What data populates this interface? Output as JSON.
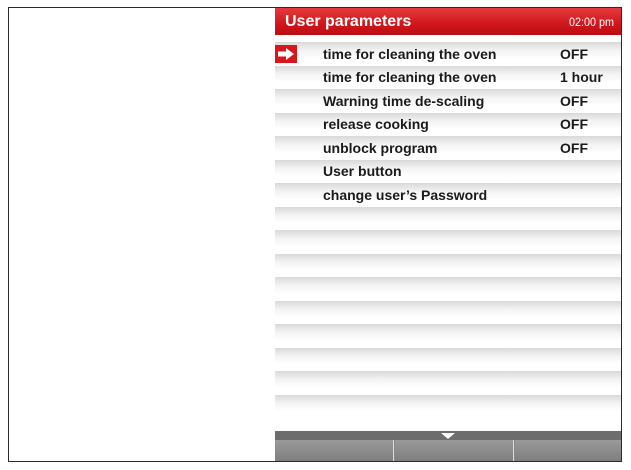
{
  "header": {
    "title": "User parameters",
    "time": "02:00 pm"
  },
  "selected_index": 0,
  "items": [
    {
      "label": "time for cleaning the oven",
      "value": "OFF"
    },
    {
      "label": "time for cleaning the oven",
      "value": "1 hour"
    },
    {
      "label": "Warning time de-scaling",
      "value": "OFF"
    },
    {
      "label": "release cooking",
      "value": "OFF"
    },
    {
      "label": "unblock program",
      "value": "OFF"
    },
    {
      "label": "User button",
      "value": ""
    },
    {
      "label": "change user’s Password",
      "value": ""
    },
    {
      "label": "",
      "value": ""
    },
    {
      "label": "",
      "value": ""
    },
    {
      "label": "",
      "value": ""
    },
    {
      "label": "",
      "value": ""
    },
    {
      "label": "",
      "value": ""
    },
    {
      "label": "",
      "value": ""
    },
    {
      "label": "",
      "value": ""
    },
    {
      "label": "",
      "value": ""
    },
    {
      "label": "",
      "value": ""
    }
  ],
  "colors": {
    "accent": "#d7161d",
    "footer": "#8a8a8a"
  }
}
